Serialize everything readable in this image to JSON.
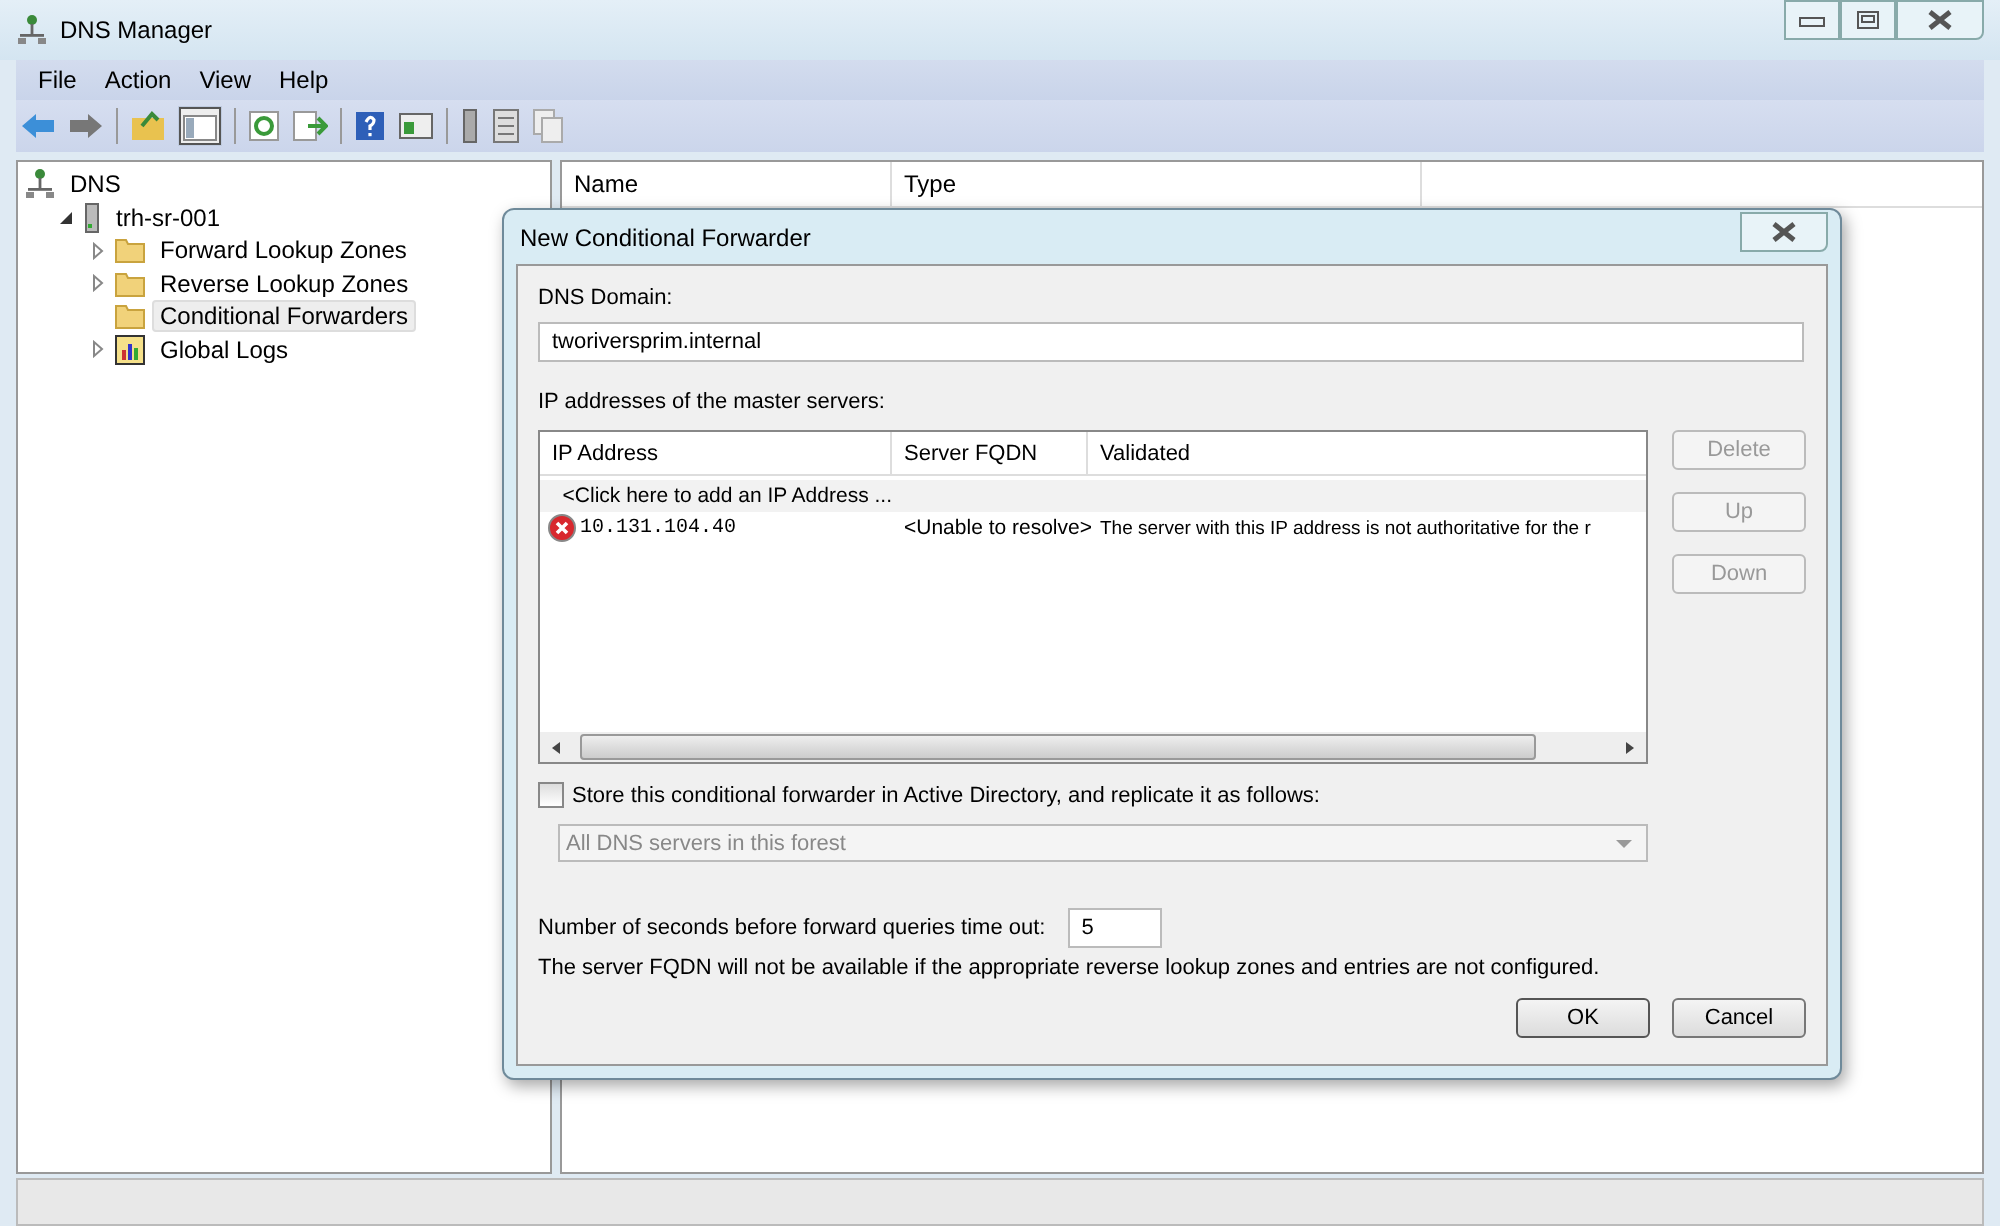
{
  "window": {
    "title": "DNS Manager"
  },
  "menu": [
    "File",
    "Action",
    "View",
    "Help"
  ],
  "tree": [
    {
      "label": "DNS",
      "kind": "dns",
      "selected": false,
      "children": [
        {
          "label": "trh-sr-001",
          "kind": "server",
          "expanded": true,
          "selected": false,
          "children": [
            {
              "label": "Forward Lookup Zones",
              "kind": "folder",
              "expanded": false,
              "selected": false
            },
            {
              "label": "Reverse Lookup Zones",
              "kind": "folder",
              "expanded": false,
              "selected": false
            },
            {
              "label": "Conditional Forwarders",
              "kind": "folder",
              "selected": true
            },
            {
              "label": "Global Logs",
              "kind": "logs",
              "expanded": false,
              "selected": false
            }
          ]
        }
      ]
    }
  ],
  "list": {
    "columns": [
      "Name",
      "Type"
    ]
  },
  "dialog": {
    "title": "New Conditional Forwarder",
    "domain_label": "DNS Domain:",
    "domain_value": "tworiversprim.internal",
    "servers_label": "IP addresses of the master servers:",
    "table": {
      "columns": [
        "IP Address",
        "Server FQDN",
        "Validated"
      ],
      "rows": [
        {
          "kind": "add",
          "ip": "<Click here to add an IP Address ...",
          "selected": true
        },
        {
          "kind": "error",
          "ip": "10.131.104.40",
          "fqdn": "<Unable to resolve>",
          "validated": "The server with this IP address is not authoritative for the r",
          "selected": false
        }
      ]
    },
    "side_buttons": [
      {
        "label": "Delete",
        "disabled": true
      },
      {
        "label": "Up",
        "disabled": true
      },
      {
        "label": "Down",
        "disabled": true
      }
    ],
    "store_checkbox": {
      "label": "Store this conditional forwarder in Active Directory, and replicate it as follows:",
      "checked": false
    },
    "replication": {
      "value": "All DNS servers in this forest",
      "disabled": true
    },
    "timeout_label": "Number of seconds before forward queries time out:",
    "timeout_value": "5",
    "note": "The server FQDN will not be available if the appropriate reverse lookup zones and entries are not configured.",
    "buttons": [
      "OK",
      "Cancel"
    ]
  }
}
